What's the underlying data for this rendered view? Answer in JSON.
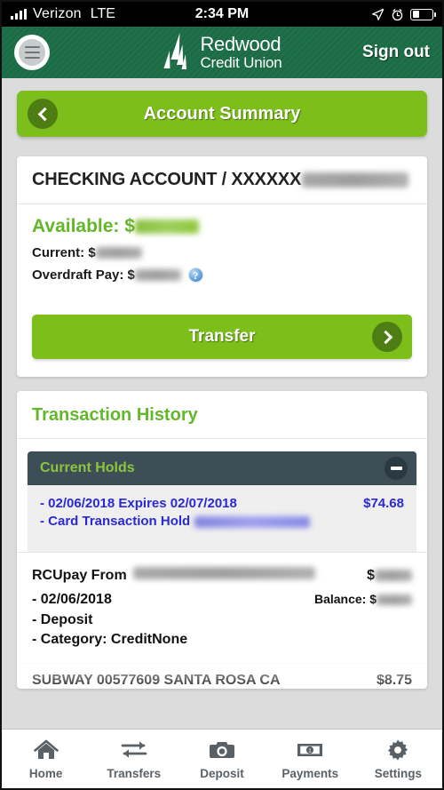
{
  "status_bar": {
    "carrier": "Verizon",
    "network": "LTE",
    "time": "2:34 PM",
    "icons": [
      "location-arrow-icon",
      "alarm-clock-icon",
      "battery-icon"
    ],
    "battery_level_pct": 38
  },
  "header": {
    "menu_icon": "hamburger-menu-icon",
    "brand_line1": "Redwood",
    "brand_line2": "Credit Union",
    "sign_out": "Sign out"
  },
  "page_bar": {
    "back_icon": "chevron-left-icon",
    "title": "Account Summary"
  },
  "account": {
    "title_prefix": "CHECKING ACCOUNT / XXXXXX",
    "title_masked": true,
    "available_label": "Available: $",
    "available_masked": true,
    "current_label": "Current: $",
    "current_masked": true,
    "overdraft_label": "Overdraft Pay: $",
    "overdraft_masked": true,
    "help_icon": "help-question-icon",
    "help_glyph": "?",
    "transfer_label": "Transfer",
    "transfer_icon": "chevron-right-icon"
  },
  "transaction_history": {
    "title": "Transaction History",
    "holds": {
      "title": "Current Holds",
      "collapse_icon": "minus-collapse-icon",
      "items": [
        {
          "line1": "- 02/06/2018  Expires 02/07/2018",
          "amount": "$74.68",
          "line2_prefix": "- Card Transaction Hold",
          "line2_masked": true
        }
      ]
    },
    "transactions": [
      {
        "description_prefix": "RCUpay From",
        "description_masked": true,
        "amount_prefix": "$",
        "amount_masked": true,
        "detail_lines": [
          "- 02/06/2018",
          "- Deposit",
          "- Category: CreditNone"
        ],
        "balance_label": "Balance: $",
        "balance_masked": true
      },
      {
        "description": "SUBWAY 00577609 SANTA ROSA CA",
        "amount": "$8.75",
        "partially_visible": true
      }
    ]
  },
  "tab_bar": {
    "items": [
      {
        "label": "Home",
        "icon": "home-icon"
      },
      {
        "label": "Transfers",
        "icon": "transfer-arrows-icon"
      },
      {
        "label": "Deposit",
        "icon": "camera-icon"
      },
      {
        "label": "Payments",
        "icon": "dollar-bill-icon"
      },
      {
        "label": "Settings",
        "icon": "gear-icon"
      }
    ]
  },
  "colors": {
    "header_green": "#1b6b45",
    "lime_green": "#7cbe1a",
    "accent_green": "#63b72a",
    "holds_bar": "#3d4e57",
    "hold_text_blue": "#2a28d8"
  }
}
